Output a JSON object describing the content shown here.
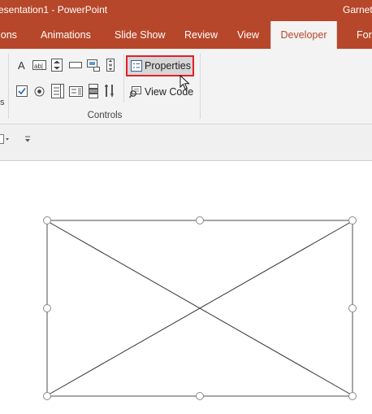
{
  "window": {
    "document_title": "esentation1  -  PowerPoint",
    "user": "Garnet"
  },
  "tabs": [
    {
      "label": "ions",
      "active": false
    },
    {
      "label": "Animations",
      "active": false
    },
    {
      "label": "Slide Show",
      "active": false
    },
    {
      "label": "Review",
      "active": false
    },
    {
      "label": "View",
      "active": false
    },
    {
      "label": "Developer",
      "active": true
    },
    {
      "label": "Forr",
      "active": false
    }
  ],
  "ribbon": {
    "left_edge_text": "s",
    "controls_group": {
      "label": "Controls",
      "properties_label": "Properties",
      "view_code_label": "View Code"
    }
  },
  "icons": [
    "label-icon",
    "textbox-icon",
    "spin-button-icon",
    "command-button-icon",
    "image-icon",
    "scrollbar-icon",
    "checkbox-icon",
    "option-button-icon",
    "listbox-icon",
    "combobox-icon",
    "toggle-button-icon",
    "more-controls-icon",
    "properties-icon",
    "view-code-icon",
    "mouse-cursor-icon"
  ],
  "colors": {
    "accent": "#b7472a",
    "highlight": "#e0202a",
    "ribbon": "#f3f3f3"
  }
}
